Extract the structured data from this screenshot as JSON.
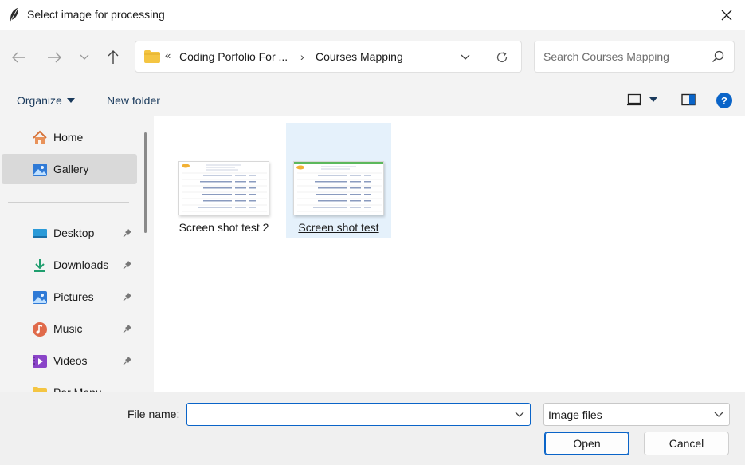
{
  "window": {
    "title": "Select image for processing"
  },
  "nav": {
    "breadcrumb_prefix": "«",
    "breadcrumb": [
      "Coding Porfolio For ...",
      "Courses Mapping"
    ],
    "separator": "›",
    "search_placeholder": "Search Courses Mapping"
  },
  "toolbar": {
    "organize_label": "Organize",
    "new_folder_label": "New folder",
    "help_label": "?"
  },
  "sidebar": {
    "items": [
      {
        "label": "Home",
        "icon": "home-icon",
        "pinned": false,
        "selected": false
      },
      {
        "label": "Gallery",
        "icon": "gallery-icon",
        "pinned": false,
        "selected": true
      },
      {
        "label": "Desktop",
        "icon": "desktop-icon",
        "pinned": true,
        "selected": false
      },
      {
        "label": "Downloads",
        "icon": "downloads-icon",
        "pinned": true,
        "selected": false
      },
      {
        "label": "Pictures",
        "icon": "pictures-icon",
        "pinned": true,
        "selected": false
      },
      {
        "label": "Music",
        "icon": "music-icon",
        "pinned": true,
        "selected": false
      },
      {
        "label": "Videos",
        "icon": "videos-icon",
        "pinned": true,
        "selected": false
      },
      {
        "label": "Par Menu",
        "icon": "folder-icon",
        "pinned": false,
        "selected": false
      }
    ]
  },
  "files": [
    {
      "name": "Screen shot test 2",
      "selected": false
    },
    {
      "name": "Screen shot test",
      "selected": true
    }
  ],
  "footer": {
    "file_name_label": "File name:",
    "file_name_value": "",
    "file_type_filter": "Image files",
    "open_label": "Open",
    "cancel_label": "Cancel"
  },
  "colors": {
    "accent": "#0a64c8",
    "selection": "#e5f1fb",
    "sidebar_selected": "#d9d9d9",
    "folder": "#f4c542"
  }
}
